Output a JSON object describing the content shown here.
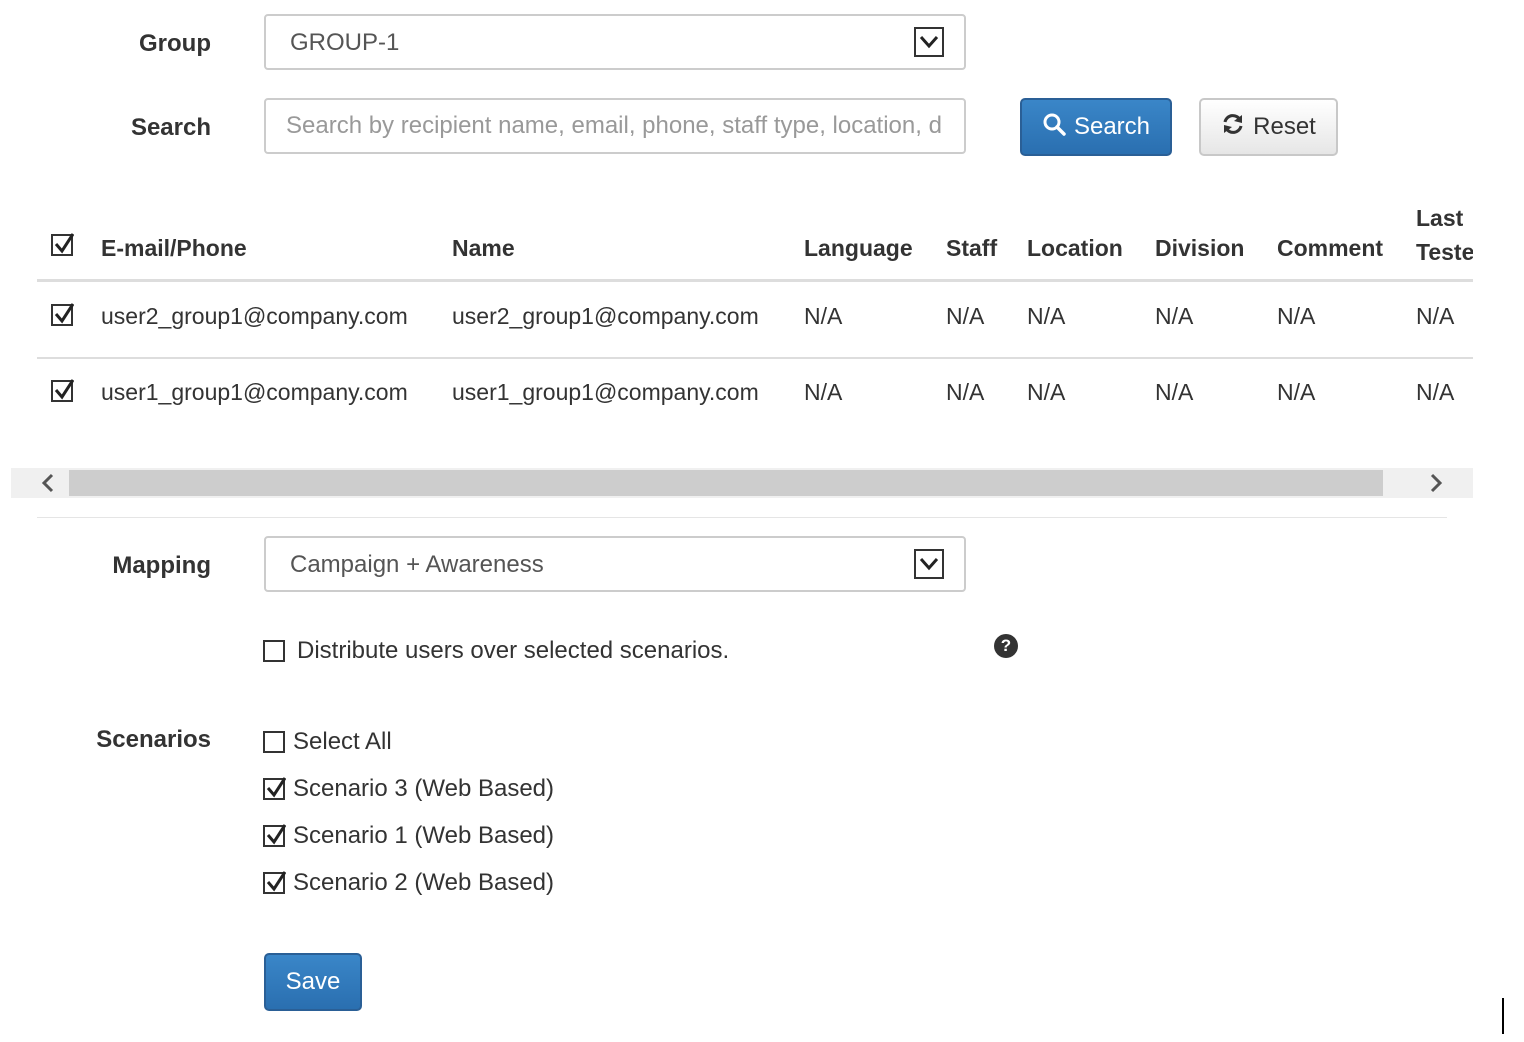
{
  "group": {
    "label": "Group",
    "selected": "GROUP-1"
  },
  "search": {
    "label": "Search",
    "placeholder": "Search by recipient name, email, phone, staff type, location, d",
    "search_button": "Search",
    "reset_button": "Reset"
  },
  "table": {
    "columns": [
      "E-mail/Phone",
      "Name",
      "Language",
      "Staff",
      "Location",
      "Division",
      "Comment",
      "Last Teste"
    ],
    "header_checkbox_checked": true,
    "rows": [
      {
        "checked": true,
        "cells": [
          "user2_group1@company.com",
          "user2_group1@company.com",
          "N/A",
          "N/A",
          "N/A",
          "N/A",
          "N/A",
          "N/A"
        ]
      },
      {
        "checked": true,
        "cells": [
          "user1_group1@company.com",
          "user1_group1@company.com",
          "N/A",
          "N/A",
          "N/A",
          "N/A",
          "N/A",
          "N/A"
        ]
      }
    ]
  },
  "mapping": {
    "label": "Mapping",
    "selected": "Campaign + Awareness",
    "distribute_label": "Distribute users over selected scenarios.",
    "distribute_checked": false
  },
  "scenarios": {
    "label": "Scenarios",
    "select_all": "Select All",
    "select_all_checked": false,
    "items": [
      {
        "label": "Scenario 3 (Web Based)",
        "checked": true
      },
      {
        "label": "Scenario 1 (Web Based)",
        "checked": true
      },
      {
        "label": "Scenario 2 (Web Based)",
        "checked": true
      }
    ]
  },
  "save_button": "Save",
  "icons": {
    "dropdown": "chevron-down-icon",
    "search": "search-icon",
    "reset": "refresh-icon",
    "help": "question-circle-icon",
    "scroll_left": "chevron-left-icon",
    "scroll_right": "chevron-right-icon"
  },
  "colors": {
    "primary": "#2a6fb0",
    "text": "#333333",
    "placeholder": "#999999"
  }
}
